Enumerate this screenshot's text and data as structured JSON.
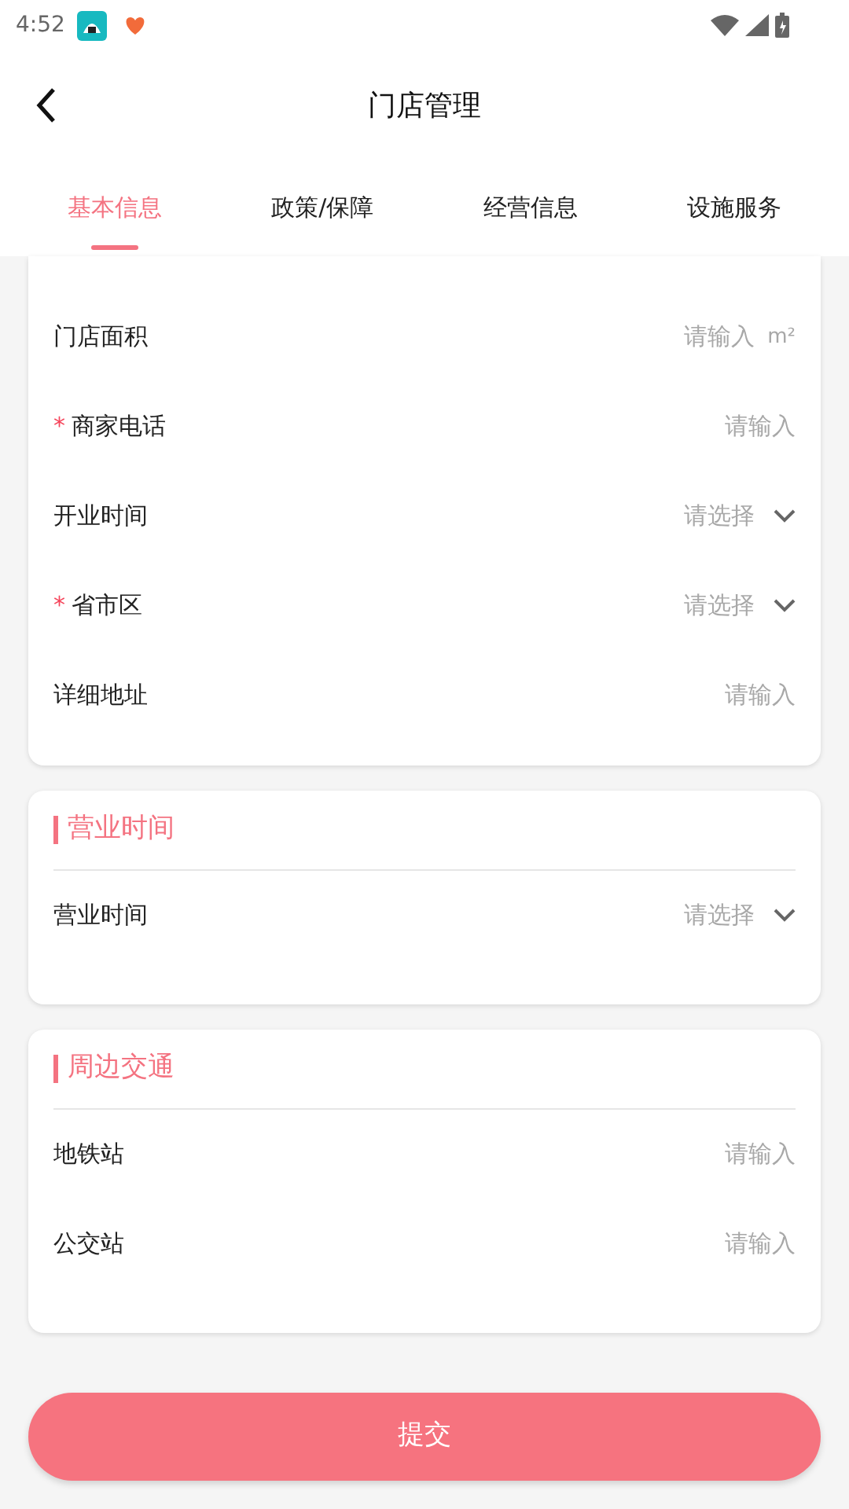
{
  "status_bar": {
    "time": "4:52"
  },
  "header": {
    "title": "门店管理"
  },
  "tabs": [
    {
      "label": "基本信息",
      "selected": true
    },
    {
      "label": "政策/保障",
      "selected": false
    },
    {
      "label": "经营信息",
      "selected": false
    },
    {
      "label": "设施服务",
      "selected": false
    }
  ],
  "sections": [
    {
      "fields": [
        {
          "label": "门店面积",
          "kind": "input",
          "placeholder": "请输入",
          "unit": "m²"
        },
        {
          "label": "商家电话",
          "required_mark": "*",
          "kind": "input",
          "placeholder": "请输入"
        },
        {
          "label": "开业时间",
          "kind": "select",
          "placeholder": "请选择"
        },
        {
          "label": "省市区",
          "required_mark": "*",
          "kind": "select",
          "placeholder": "请选择"
        },
        {
          "label": "详细地址",
          "kind": "input",
          "placeholder": "请输入"
        }
      ]
    },
    {
      "title": "营业时间",
      "fields": [
        {
          "label": "营业时间",
          "kind": "select",
          "placeholder": "请选择"
        }
      ]
    },
    {
      "title": "周边交通",
      "fields": [
        {
          "label": "地铁站",
          "kind": "input",
          "placeholder": "请输入"
        },
        {
          "label": "公交站",
          "kind": "input",
          "placeholder": "请输入"
        }
      ]
    }
  ],
  "submit_button": "提交"
}
